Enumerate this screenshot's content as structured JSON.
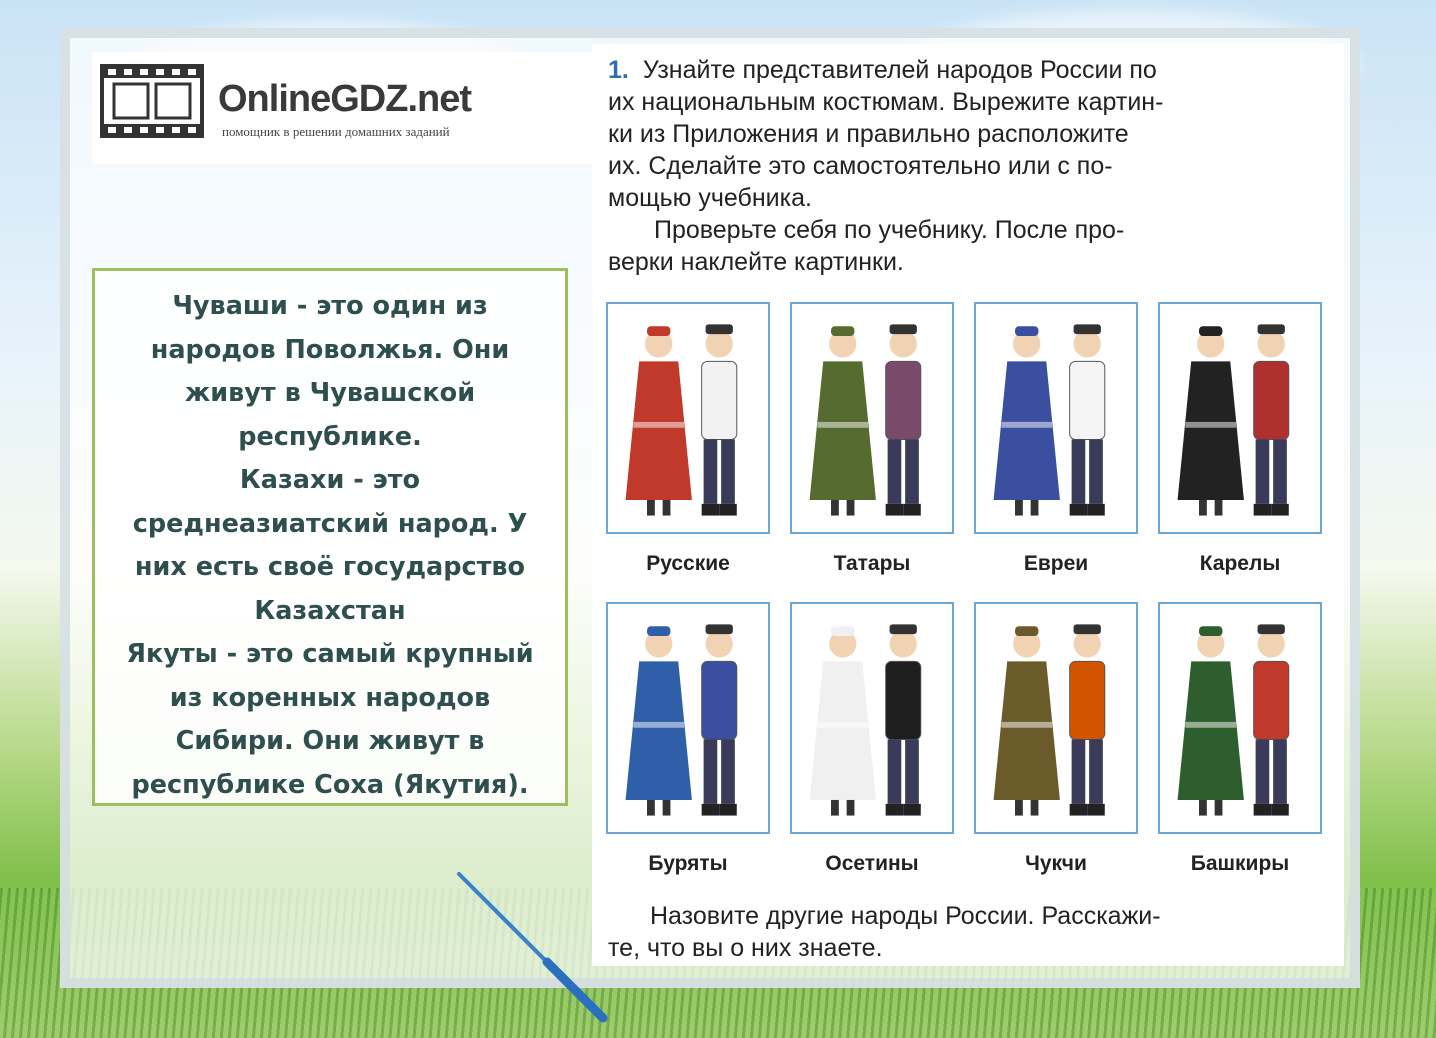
{
  "logo": {
    "title": "OnlineGDZ.net",
    "subtitle": "помощник в решении домашних заданий"
  },
  "info_box": {
    "lines": [
      "Чуваши - это один из",
      "народов Поволжья. Они",
      "живут в Чувашской",
      "республике.",
      "Казахи - это",
      "среднеазиатский народ. У",
      "них есть своё государство",
      "Казахстан",
      "Якуты - это самый крупный",
      "из коренных народов",
      "Сибири. Они живут в",
      "республике Соха (Якутия)."
    ]
  },
  "task": {
    "number": "1.",
    "lines": [
      "Узнайте представителей народов России по",
      "их национальным костюмам. Вырежите картин-",
      "ки из Приложения и правильно расположите",
      "их. Сделайте это самостоятельно или с по-",
      "мощью учебника.",
      "Проверьте себя по учебнику. После про-",
      "верки наклейте картинки."
    ],
    "bottom_lines": [
      "Назовите другие народы России. Расскажи-",
      "те, что вы о них знаете."
    ]
  },
  "peoples": [
    {
      "name": "Русские",
      "colors": [
        "#c0392b",
        "#f2f2f2"
      ]
    },
    {
      "name": "Татары",
      "colors": [
        "#556b2f",
        "#7a4a6a"
      ]
    },
    {
      "name": "Евреи",
      "colors": [
        "#3b4fa0",
        "#f5f5f5"
      ]
    },
    {
      "name": "Карелы",
      "colors": [
        "#222222",
        "#b03030"
      ]
    },
    {
      "name": "Буряты",
      "colors": [
        "#2f5fa8",
        "#3a4fa0"
      ]
    },
    {
      "name": "Осетины",
      "colors": [
        "#f0f0f0",
        "#1e1e1e"
      ]
    },
    {
      "name": "Чукчи",
      "colors": [
        "#6b5a2a",
        "#d35400"
      ]
    },
    {
      "name": "Башкиры",
      "colors": [
        "#2e5e2e",
        "#c0392b"
      ]
    }
  ]
}
